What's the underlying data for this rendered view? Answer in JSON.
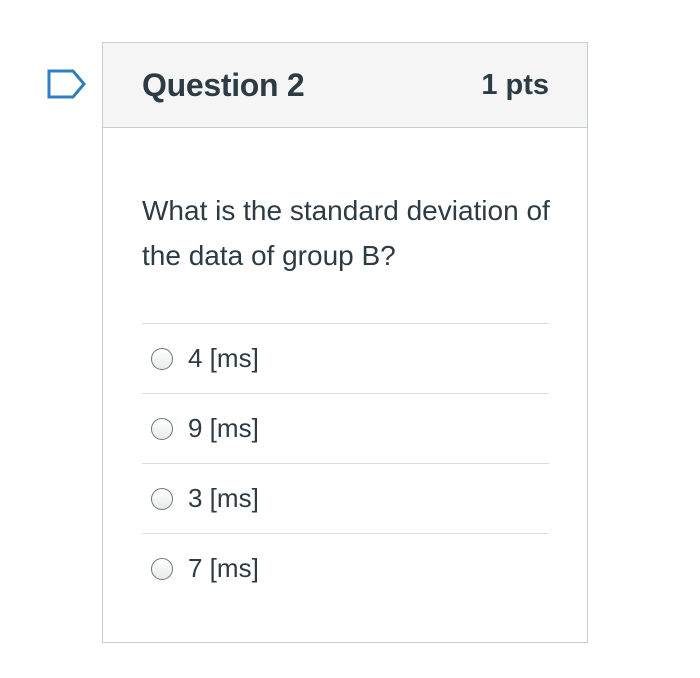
{
  "question": {
    "title": "Question 2",
    "points": "1 pts",
    "text": "What is the standard deviation of the data of group B?",
    "flag_icon": "bookmark-flag-icon",
    "answers": [
      {
        "label": "4 [ms]",
        "selected": false
      },
      {
        "label": "9 [ms]",
        "selected": false
      },
      {
        "label": "3 [ms]",
        "selected": false
      },
      {
        "label": "7 [ms]",
        "selected": false
      }
    ]
  },
  "colors": {
    "flag": "#2d7fc1",
    "header_bg": "#f5f5f5",
    "border": "#c7cdd1",
    "text": "#2d3b45"
  }
}
